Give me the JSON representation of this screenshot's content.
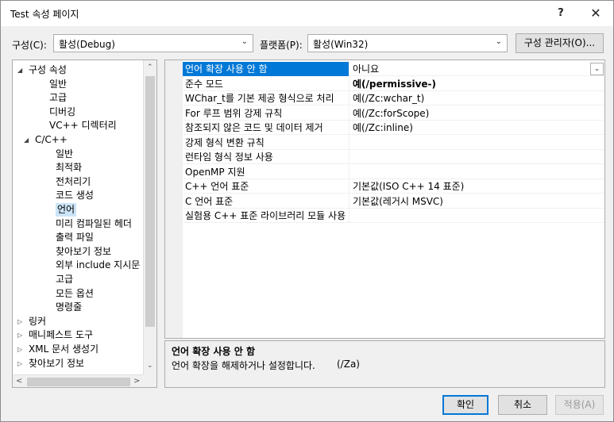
{
  "window": {
    "title": "Test 속성 페이지",
    "help_label": "?",
    "close_label": "✕"
  },
  "config": {
    "config_label": "구성(C):",
    "config_value": "활성(Debug)",
    "platform_label": "플랫폼(P):",
    "platform_value": "활성(Win32)",
    "manager_button": "구성 관리자(O)..."
  },
  "tree": {
    "items": [
      {
        "label": "구성 속성",
        "expander": "◢"
      },
      {
        "label": "일반"
      },
      {
        "label": "고급"
      },
      {
        "label": "디버깅"
      },
      {
        "label": "VC++ 디렉터리"
      },
      {
        "label": "C/C++",
        "expander": "◢"
      },
      {
        "label": "일반"
      },
      {
        "label": "최적화"
      },
      {
        "label": "전처리기"
      },
      {
        "label": "코드 생성"
      },
      {
        "label": "언어"
      },
      {
        "label": "미리 컴파일된 헤더"
      },
      {
        "label": "출력 파일"
      },
      {
        "label": "찾아보기 정보"
      },
      {
        "label": "외부 include 지시문"
      },
      {
        "label": "고급"
      },
      {
        "label": "모든 옵션"
      },
      {
        "label": "명령줄"
      },
      {
        "label": "링커",
        "expander": "▷"
      },
      {
        "label": "매니페스트 도구",
        "expander": "▷"
      },
      {
        "label": "XML 문서 생성기",
        "expander": "▷"
      },
      {
        "label": "찾아보기 정보",
        "expander": "▷"
      }
    ],
    "selected_label": "언어"
  },
  "properties": {
    "rows": [
      {
        "name": "언어 확장 사용 안 함",
        "value": "아니요"
      },
      {
        "name": "준수 모드",
        "value": "예(/permissive-)"
      },
      {
        "name": "WChar_t를 기본 제공 형식으로 처리",
        "value": "예(/Zc:wchar_t)"
      },
      {
        "name": "For 루프 범위 강제 규칙",
        "value": "예(/Zc:forScope)"
      },
      {
        "name": "참조되지 않은 코드 및 데이터 제거",
        "value": "예(/Zc:inline)"
      },
      {
        "name": "강제 형식 변환 규칙",
        "value": ""
      },
      {
        "name": "런타임 형식 정보 사용",
        "value": ""
      },
      {
        "name": "OpenMP 지원",
        "value": ""
      },
      {
        "name": "C++ 언어 표준",
        "value": "기본값(ISO C++ 14 표준)"
      },
      {
        "name": "C 언어 표준",
        "value": "기본값(레거시 MSVC)"
      },
      {
        "name": "실험용 C++ 표준 라이브러리 모듈 사용",
        "value": ""
      }
    ]
  },
  "description": {
    "title": "언어 확장 사용 안 함",
    "text": "언어 확장을 해제하거나 설정합니다.",
    "switch": "(/Za)"
  },
  "buttons": {
    "ok": "확인",
    "cancel": "취소",
    "apply": "적용(A)"
  },
  "icons": {
    "dropdown": "chevron-down-icon",
    "expanded": "triangle-expanded-icon",
    "collapsed": "triangle-collapsed-icon"
  },
  "colors": {
    "selection": "#0078d7",
    "tree_selection": "#cce4f7"
  }
}
